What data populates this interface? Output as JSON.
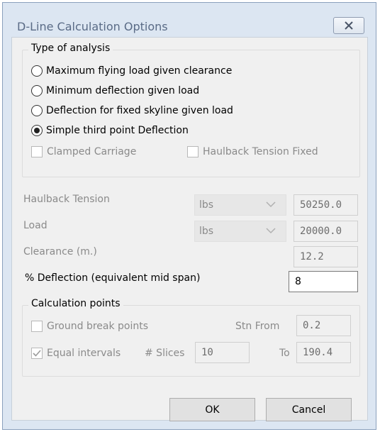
{
  "window": {
    "title": "D-Line Calculation Options"
  },
  "analysis": {
    "group_title": "Type of analysis",
    "options": [
      {
        "label": "Maximum flying load given clearance",
        "selected": false
      },
      {
        "label": "Minimum deflection given load",
        "selected": false
      },
      {
        "label": "Deflection for fixed skyline given load",
        "selected": false
      },
      {
        "label": "Simple third point Deflection",
        "selected": true
      }
    ],
    "clamped_carriage": {
      "label": "Clamped Carriage",
      "checked": false,
      "enabled": false
    },
    "haulback_fixed": {
      "label": "Haulback Tension Fixed",
      "checked": false,
      "enabled": false
    }
  },
  "params": {
    "haulback": {
      "label": "Haulback Tension",
      "unit": "lbs",
      "value": "50250.0"
    },
    "load": {
      "label": "Load",
      "unit": "lbs",
      "value": "20000.0"
    },
    "clearance": {
      "label": "Clearance (m.)",
      "value": "12.2"
    },
    "deflection": {
      "label": "% Deflection (equivalent mid span)",
      "value": "8"
    }
  },
  "calc_points": {
    "group_title": "Calculation points",
    "ground_break": {
      "label": "Ground break points",
      "checked": false
    },
    "stn_from_label": "Stn From",
    "stn_from_value": "0.2",
    "equal_intervals": {
      "label": "Equal intervals",
      "checked": true
    },
    "slices_label": "# Slices",
    "slices_value": "10",
    "to_label": "To",
    "to_value": "190.4"
  },
  "buttons": {
    "ok": "OK",
    "cancel": "Cancel"
  },
  "colors": {
    "client_bg": "#f0f0f0",
    "frame_bg": "#dce6f2",
    "disabled_text": "#8a8a8a"
  }
}
